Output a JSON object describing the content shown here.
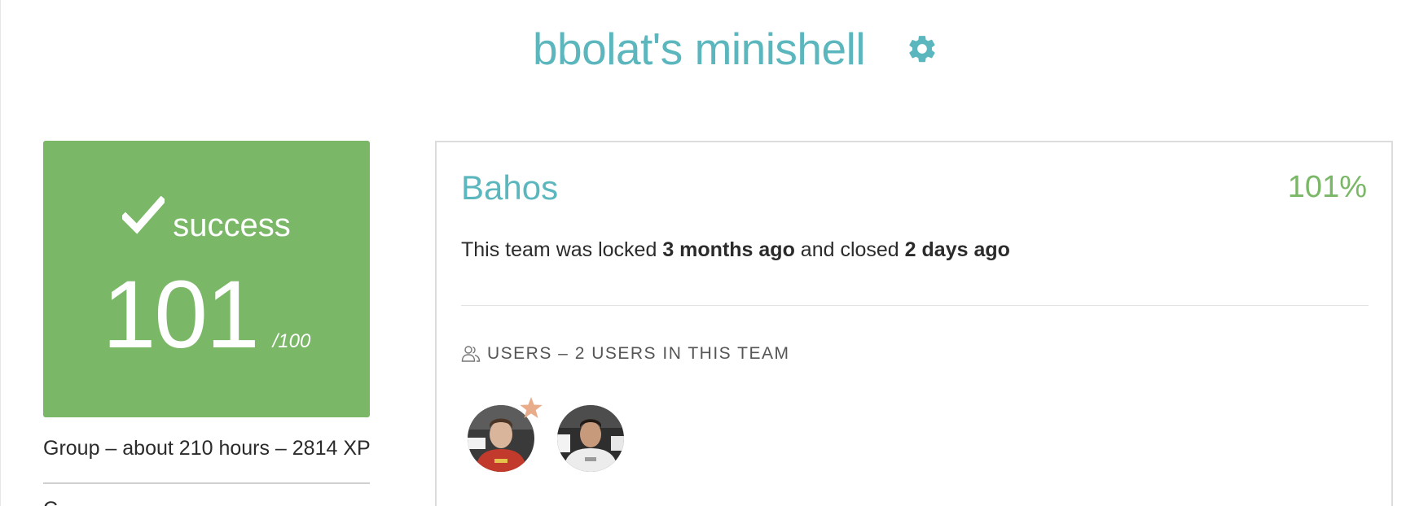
{
  "project": {
    "title": "bbolat's minishell"
  },
  "status": {
    "label": "success",
    "score": "101",
    "max": "/100",
    "color": "#7ab767"
  },
  "group_info": "Group – about 210 hours – 2814 XP",
  "cut_text": "C",
  "team": {
    "name": "Bahos",
    "percent": "101%",
    "lock_prefix": "This team was locked ",
    "locked_ago": "3 months ago",
    "closed_mid": " and closed ",
    "closed_ago": "2 days ago",
    "users_header": "USERS – 2 USERS IN THIS TEAM",
    "members": [
      {
        "avatar": "user-avatar-1",
        "leader": true
      },
      {
        "avatar": "user-avatar-2",
        "leader": false
      }
    ]
  },
  "colors": {
    "accent": "#5bb7bd",
    "success": "#7ab767",
    "star": "#e8ac8a"
  },
  "icons": [
    "gear-icon",
    "check-icon",
    "users-icon",
    "star-icon"
  ]
}
